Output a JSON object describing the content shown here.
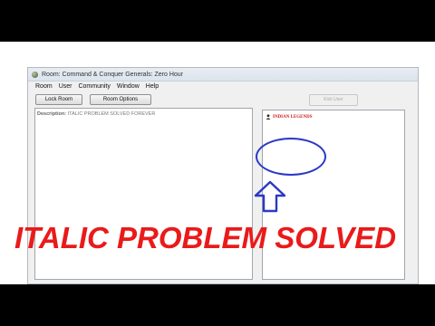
{
  "window": {
    "title": "Room: Command & Conquer Generals: Zero Hour"
  },
  "menu": [
    "Room",
    "User",
    "Community",
    "Window",
    "Help"
  ],
  "toolbar": {
    "lock_room_label": "Lock Room",
    "room_options_label": "Room Options",
    "kick_user_label": "Kick User"
  },
  "description": {
    "label": "Description:",
    "text": "ITALIC PROBLEM SOLVED FOREVER"
  },
  "users": [
    {
      "name": "INDIAN LEGENDS"
    }
  ],
  "overlay": {
    "headline": "ITALIC PROBLEM SOLVED",
    "headline_color": "#ea1a1a",
    "annotation_color": "#2b38c5"
  }
}
